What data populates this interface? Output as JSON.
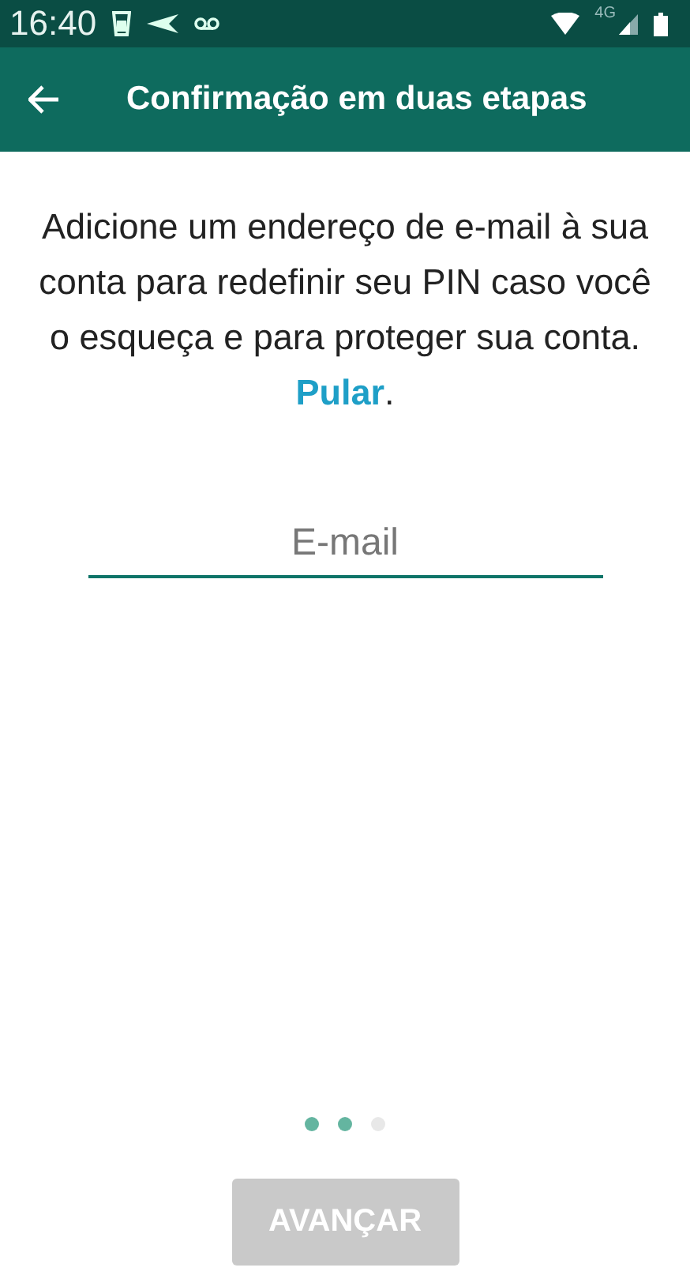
{
  "status_bar": {
    "time": "16:40",
    "network": "4G"
  },
  "toolbar": {
    "title": "Confirmação em duas etapas"
  },
  "description": {
    "text": "Adicione um endereço de e-mail à sua conta para redefinir seu PIN caso você o esqueça e para proteger sua conta.",
    "link": "Pular",
    "after": "."
  },
  "email_field": {
    "placeholder": "E-mail"
  },
  "steps": [
    {
      "filled": true
    },
    {
      "filled": true
    },
    {
      "filled": false
    }
  ],
  "next_button": {
    "label": "AVANÇAR",
    "disabled": true
  }
}
